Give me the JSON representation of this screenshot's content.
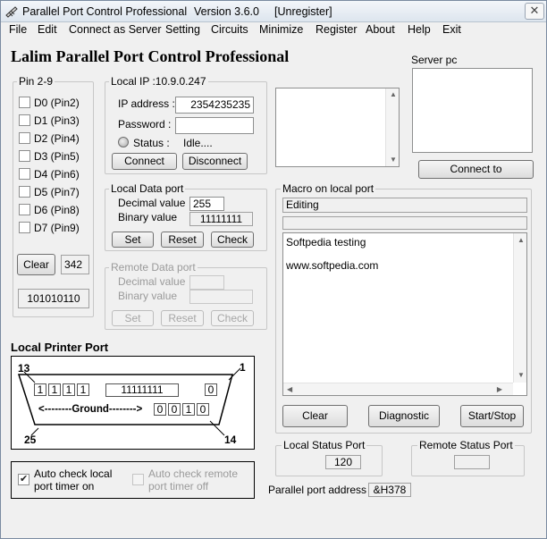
{
  "titlebar": {
    "app_title": "Parallel Port Control Professional",
    "version": "Version 3.6.0",
    "status": "[Unregister]",
    "close_glyph": "✕"
  },
  "menu": [
    "File",
    "Edit",
    "Connect as Server",
    "Setting",
    "Circuits",
    "Minimize",
    "Register",
    "About",
    "Help",
    "Exit"
  ],
  "heading": "Lalim Parallel Port Control Professional",
  "pins": {
    "group_label": "Pin 2-9",
    "items": [
      {
        "label": "D0  (Pin2)"
      },
      {
        "label": "D1  (Pin3)"
      },
      {
        "label": "D2  (Pin4)"
      },
      {
        "label": "D3  (Pin5)"
      },
      {
        "label": "D4  (Pin6)"
      },
      {
        "label": "D5  (Pin7)"
      },
      {
        "label": "D6  (Pin8)"
      },
      {
        "label": "D7  (Pin9)"
      }
    ],
    "clear_label": "Clear",
    "port_value": "342",
    "binary_value": "101010110"
  },
  "local_ip": {
    "group_label": "Local IP   :10.9.0.247",
    "ip_label": "IP address :",
    "ip_value": "2354235235",
    "password_label": "Password :",
    "password_value": "",
    "status_label": "Status :",
    "status_value": "Idle....",
    "connect_label": "Connect",
    "disconnect_label": "Disconnect"
  },
  "server": {
    "label": "Server pc",
    "connect_to_label": "Connect to"
  },
  "local_data": {
    "group_label": "Local Data port",
    "decimal_label": "Decimal value",
    "decimal_value": "255",
    "binary_label": "Binary value",
    "binary_value": "11111111",
    "set_label": "Set",
    "reset_label": "Reset",
    "check_label": "Check"
  },
  "remote_data": {
    "group_label": "Remote Data port",
    "decimal_label": "Decimal value",
    "decimal_value": "",
    "binary_label": "Binary value",
    "binary_value": "",
    "set_label": "Set",
    "reset_label": "Reset",
    "check_label": "Check"
  },
  "macro": {
    "group_label": "Macro on local port",
    "mode": "Editing",
    "lines": [
      "Softpedia testing",
      "www.softpedia.com"
    ],
    "clear_label": "Clear",
    "diagnostic_label": "Diagnostic",
    "startstop_label": "Start/Stop"
  },
  "printer": {
    "title": "Local Printer Port",
    "pin13": "13",
    "pin1": "1",
    "pin25": "25",
    "pin14": "14",
    "data_bits": [
      "1",
      "1",
      "1",
      "1"
    ],
    "data_value": "11111111",
    "control_bit": "0",
    "ground_label": "<--------Ground-------->",
    "status_bits": [
      "0",
      "0",
      "1",
      "0"
    ]
  },
  "auto_check": {
    "local_label_1": "Auto check local",
    "local_label_2": "port timer on",
    "remote_label_1": "Auto check remote",
    "remote_label_2": "port timer off"
  },
  "local_status": {
    "label": "Local Status Port",
    "value": "120"
  },
  "remote_status": {
    "label": "Remote Status Port",
    "value": ""
  },
  "address": {
    "label": "Parallel port address :",
    "value": "&H378"
  },
  "colors": {
    "window_bg": "#f0f0f0",
    "titlebar_top": "#f3f6fa",
    "group_border": "#c7c7c7"
  }
}
